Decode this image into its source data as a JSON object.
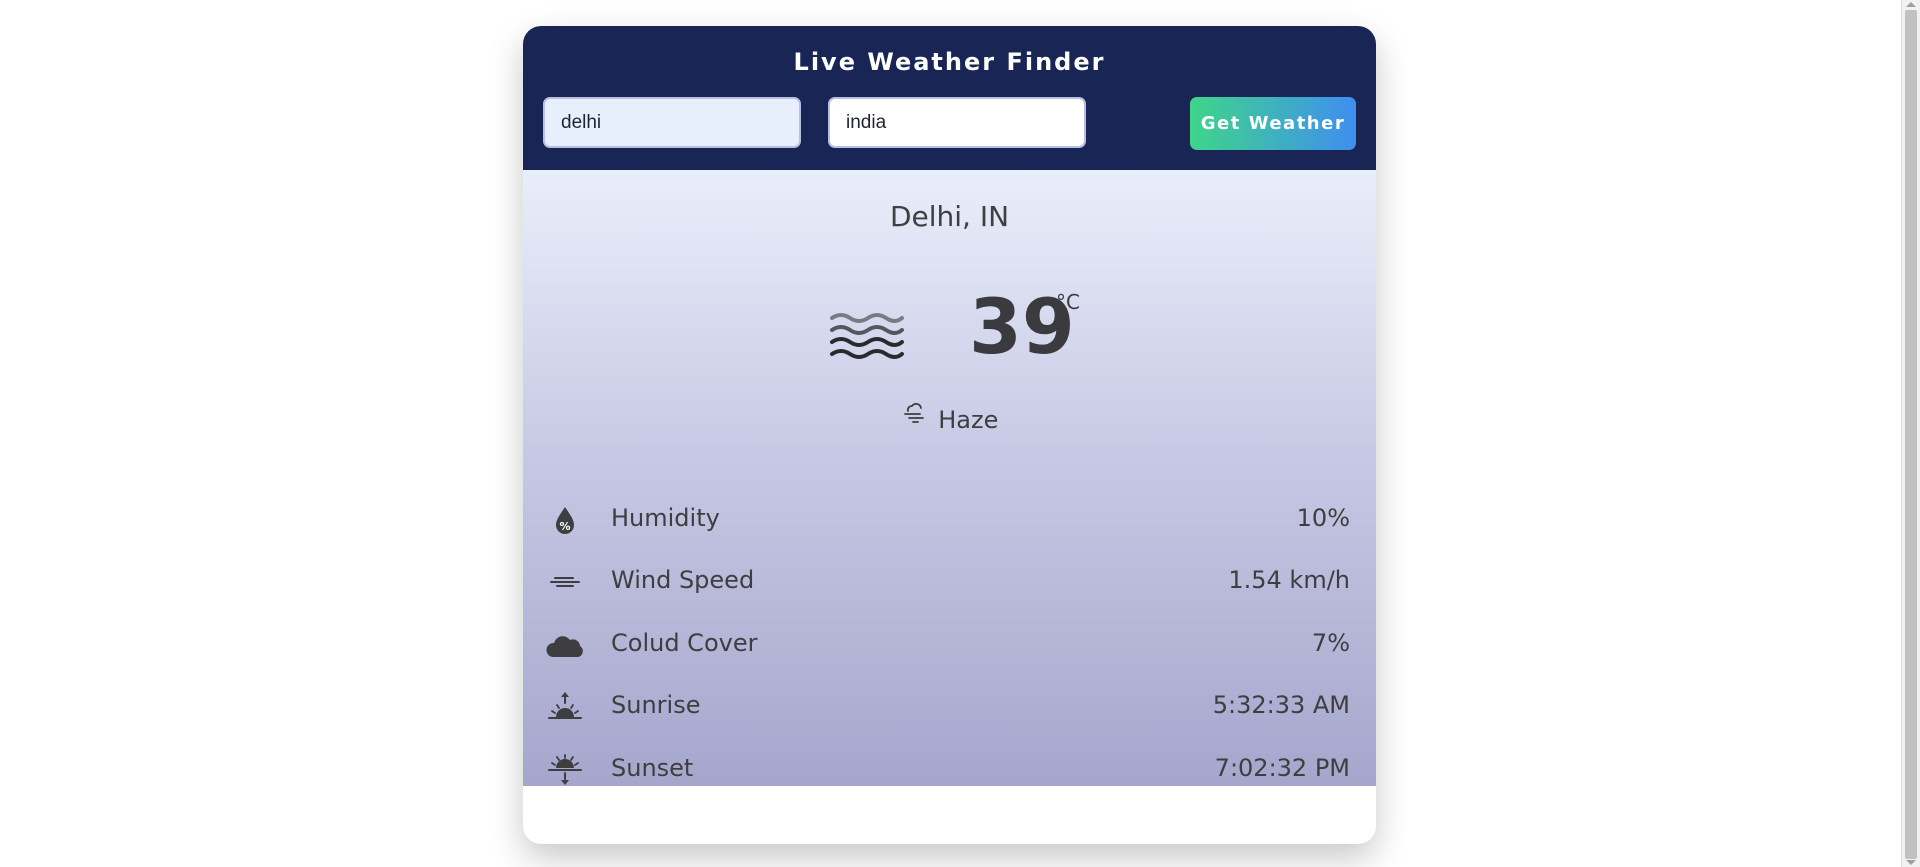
{
  "header": {
    "title": "Live Weather Finder",
    "city_input_value": "delhi",
    "country_input_value": "india",
    "button_label": "Get Weather"
  },
  "weather": {
    "location": "Delhi, IN",
    "temperature": "39",
    "unit": "°C",
    "condition": "Haze",
    "main_icon": "haze-waves-icon",
    "condition_icon": "haze-cloud-icon"
  },
  "details": [
    {
      "label": "Humidity",
      "value": "10%",
      "icon": "humidity-drop-icon"
    },
    {
      "label": "Wind Speed",
      "value": "1.54 km/h",
      "icon": "wind-icon"
    },
    {
      "label": "Colud Cover",
      "value": "7%",
      "icon": "cloud-icon"
    },
    {
      "label": "Sunrise",
      "value": "5:32:33 AM",
      "icon": "sunrise-icon"
    },
    {
      "label": "Sunset",
      "value": "7:02:32 PM",
      "icon": "sunset-icon"
    }
  ],
  "colors": {
    "header_bg": "#182555",
    "button_gradient_start": "#3fd58a",
    "button_gradient_end": "#3f8ef0",
    "body_gradient_top": "#e9eefb",
    "body_gradient_bottom": "#a6a6cd",
    "text": "#3e3e40"
  }
}
